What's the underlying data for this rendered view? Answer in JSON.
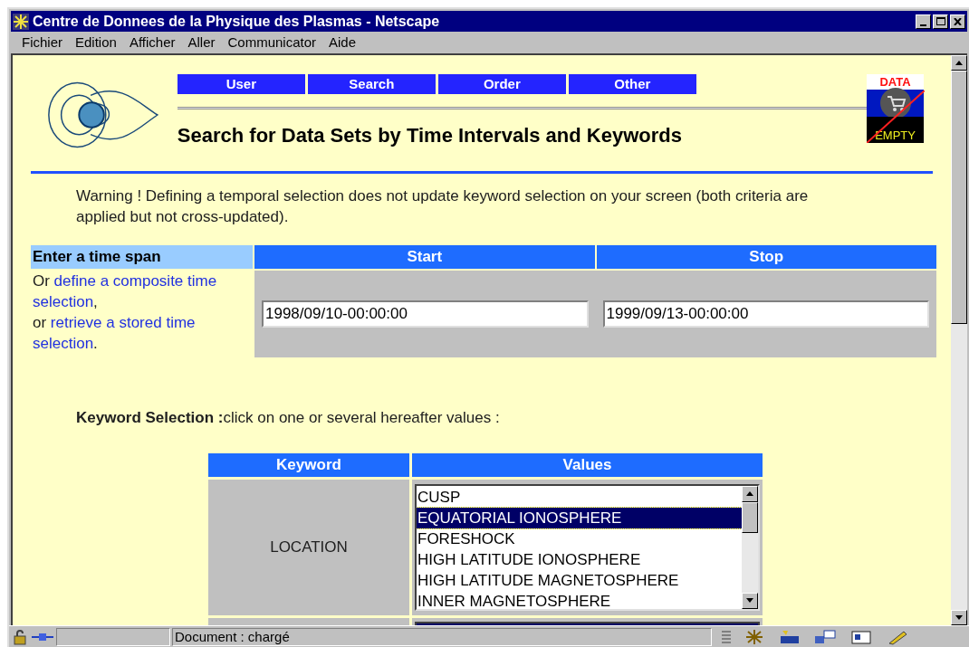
{
  "window": {
    "title": "Centre de Donnees de la Physique des Plasmas - Netscape"
  },
  "menu": [
    {
      "label": "Fichier"
    },
    {
      "label": "Edition"
    },
    {
      "label": "Afficher"
    },
    {
      "label": "Aller"
    },
    {
      "label": "Communicator"
    },
    {
      "label": "Aide"
    }
  ],
  "nav": [
    {
      "label": "User"
    },
    {
      "label": "Search"
    },
    {
      "label": "Order"
    },
    {
      "label": "Other"
    }
  ],
  "heading": "Search for Data Sets by Time Intervals and Keywords",
  "cart_badge": {
    "top": "DATA",
    "bottom": "EMPTY"
  },
  "warning": "Warning ! Defining a temporal selection does not update keyword selection on your screen (both criteria are applied but not cross-updated).",
  "time_span": {
    "header": "Enter a time span",
    "columns": [
      "Start",
      "Stop"
    ],
    "note": [
      [
        {
          "kind": "text",
          "text": "Or "
        },
        {
          "kind": "link",
          "text": "define a composite time"
        }
      ],
      [
        {
          "kind": "link",
          "text": "selection"
        },
        {
          "kind": "text",
          "text": ","
        }
      ],
      [
        {
          "kind": "text",
          "text": "or "
        },
        {
          "kind": "link",
          "text": "retrieve a stored time"
        }
      ],
      [
        {
          "kind": "link",
          "text": "selection"
        },
        {
          "kind": "text",
          "text": "."
        }
      ]
    ],
    "start": "1998/09/10-00:00:00",
    "stop": "1999/09/13-00:00:00"
  },
  "keyword_intro": "**Keyword Selection :**click on one or several hereafter values :",
  "keyword_table": {
    "columns": [
      "Keyword",
      "Values"
    ],
    "rows": [
      {
        "keyword": "LOCATION",
        "values": [
          {
            "label": "CUSP",
            "selected": false
          },
          {
            "label": "EQUATORIAL IONOSPHERE",
            "selected": true
          },
          {
            "label": "FORESHOCK",
            "selected": false
          },
          {
            "label": "HIGH LATITUDE IONOSPHERE",
            "selected": false
          },
          {
            "label": "HIGH LATITUDE MAGNETOSPHERE",
            "selected": false
          },
          {
            "label": "INNER MAGNETOSPHERE",
            "selected": false
          }
        ]
      }
    ]
  },
  "status_bar": {
    "text": "Document : chargé"
  }
}
